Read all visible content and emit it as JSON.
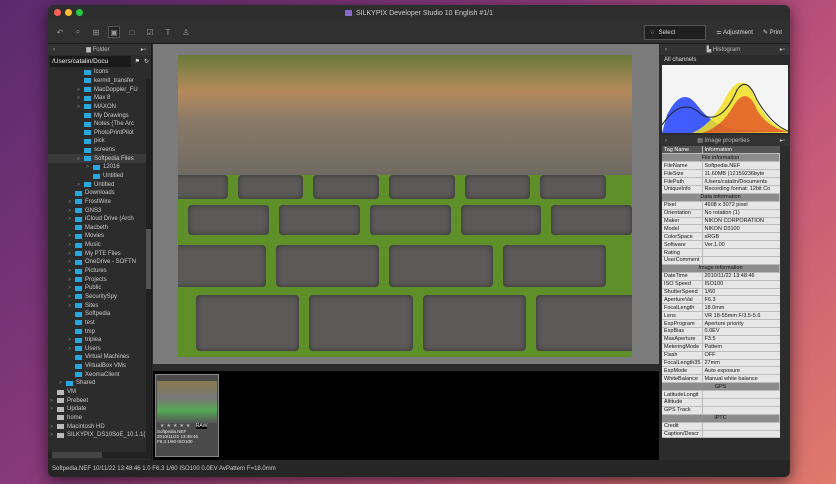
{
  "window": {
    "title": "SILKYPIX Developer Studio 10 English   #1/1"
  },
  "toolbar": {
    "select": "Select",
    "adjustment": "Adjustment",
    "print": "Print"
  },
  "folder_panel": {
    "title": "Folder",
    "path": "/Users/catalin/Docu",
    "items": [
      {
        "label": "Icons",
        "depth": 3,
        "exp": ""
      },
      {
        "label": "kermit_transfer",
        "depth": 3,
        "exp": ""
      },
      {
        "label": "MacDoppler_FU",
        "depth": 3,
        "exp": ">"
      },
      {
        "label": "Max 8",
        "depth": 3,
        "exp": ">"
      },
      {
        "label": "MAXON",
        "depth": 3,
        "exp": ">"
      },
      {
        "label": "My Drawings",
        "depth": 3,
        "exp": ""
      },
      {
        "label": "Notes (The Arc",
        "depth": 3,
        "exp": ""
      },
      {
        "label": "PhotoPrintPilot",
        "depth": 3,
        "exp": ""
      },
      {
        "label": "pick",
        "depth": 3,
        "exp": ""
      },
      {
        "label": "screens",
        "depth": 3,
        "exp": ""
      },
      {
        "label": "Softpedia Files",
        "depth": 3,
        "exp": "v",
        "sel": true
      },
      {
        "label": "12016",
        "depth": 4,
        "exp": ">"
      },
      {
        "label": "Untitled",
        "depth": 4,
        "exp": ""
      },
      {
        "label": "Untitled",
        "depth": 3,
        "exp": ">"
      },
      {
        "label": "Downloads",
        "depth": 2,
        "exp": ""
      },
      {
        "label": "FrostWire",
        "depth": 2,
        "exp": ">"
      },
      {
        "label": "GNS3",
        "depth": 2,
        "exp": ">"
      },
      {
        "label": "iCloud Drive (Arch",
        "depth": 2,
        "exp": ">"
      },
      {
        "label": "Macbeth",
        "depth": 2,
        "exp": ""
      },
      {
        "label": "Movies",
        "depth": 2,
        "exp": ">"
      },
      {
        "label": "Music",
        "depth": 2,
        "exp": ">"
      },
      {
        "label": "My PTE Files",
        "depth": 2,
        "exp": ">"
      },
      {
        "label": "OneDrive - SOFTN",
        "depth": 2,
        "exp": ">"
      },
      {
        "label": "Pictures",
        "depth": 2,
        "exp": ">"
      },
      {
        "label": "Projects",
        "depth": 2,
        "exp": ">"
      },
      {
        "label": "Public",
        "depth": 2,
        "exp": ">"
      },
      {
        "label": "SecuritySpy",
        "depth": 2,
        "exp": ">"
      },
      {
        "label": "Sites",
        "depth": 2,
        "exp": ">"
      },
      {
        "label": "Softpedia",
        "depth": 2,
        "exp": ""
      },
      {
        "label": "test",
        "depth": 2,
        "exp": ""
      },
      {
        "label": "tmp",
        "depth": 2,
        "exp": ""
      },
      {
        "label": "tripleа",
        "depth": 2,
        "exp": ">"
      },
      {
        "label": "Users",
        "depth": 2,
        "exp": ">"
      },
      {
        "label": "Virtual Machines",
        "depth": 2,
        "exp": ""
      },
      {
        "label": "VirtualBox VMs",
        "depth": 2,
        "exp": ""
      },
      {
        "label": "XeomaClient",
        "depth": 2,
        "exp": ""
      },
      {
        "label": "Shared",
        "depth": 1,
        "exp": ">"
      },
      {
        "label": "VM",
        "depth": 0,
        "exp": "",
        "g": true
      },
      {
        "label": "Prebeet",
        "depth": 0,
        "exp": ">",
        "g": true
      },
      {
        "label": "Update",
        "depth": 0,
        "exp": ">",
        "g": true
      },
      {
        "label": "home",
        "depth": 0,
        "exp": "",
        "g": true
      },
      {
        "label": "Macintosh HD",
        "depth": 0,
        "exp": ">",
        "g": true
      },
      {
        "label": "SILKYPIX_DS10SoE_10.1.1(",
        "depth": 0,
        "exp": ">",
        "g": true
      }
    ]
  },
  "thumbnail": {
    "name": "Softpedia.NEF",
    "date": "2010/11/22 13:48:46",
    "info": "F6.3 1/60 ISO100",
    "badge": "RAW"
  },
  "histogram": {
    "title": "Histogram",
    "channel": "All channels"
  },
  "properties": {
    "title": "Image properties",
    "col1": "Tag Name",
    "col2": "Information",
    "sections": [
      {
        "title": "File information",
        "rows": [
          [
            "FileName",
            "Softpedia.NEF"
          ],
          [
            "FileSize",
            "11.60MB (12159236byte"
          ],
          [
            "FilePath",
            "/Users/catalin/Documents"
          ],
          [
            "UniqueInfo",
            "Recording format: 12bit Co"
          ]
        ]
      },
      {
        "title": "Data information",
        "rows": [
          [
            "Pixel",
            "4608 x 3072 pixel"
          ],
          [
            "Orientation",
            "No rotation (1)"
          ],
          [
            "Maker",
            "NIKON CORPORATION"
          ],
          [
            "Model",
            "NIKON D3100"
          ],
          [
            "ColorSpace",
            "sRGB"
          ],
          [
            "Software",
            "Ver.1.00"
          ],
          [
            "Rating",
            ""
          ],
          [
            "UserComment",
            ""
          ]
        ]
      },
      {
        "title": "Image information",
        "rows": [
          [
            "DateTime",
            "2010/11/22 13:48:46"
          ],
          [
            "ISO Speed",
            "ISO100"
          ],
          [
            "ShutterSpeed",
            "1/60"
          ],
          [
            "ApertureVal",
            "F6.3"
          ],
          [
            "FocalLength",
            "18.0mm"
          ],
          [
            "Lens",
            "VR 18-55mm F/3.5-5.6"
          ],
          [
            "ExpProgram",
            "Aperture priority"
          ],
          [
            "ExpBias",
            "0.0EV"
          ],
          [
            "MaxAperture",
            "F3.5"
          ],
          [
            "MeteringMode",
            "Pattern"
          ],
          [
            "Flash",
            "OFF"
          ],
          [
            "FocalLength35",
            "27mm"
          ],
          [
            "ExpMode",
            "Auto exposure"
          ],
          [
            "WhiteBalance",
            "Manual white balance"
          ]
        ]
      },
      {
        "title": "GPS",
        "rows": [
          [
            "LatitudeLongit",
            ""
          ],
          [
            "Altitude",
            ""
          ],
          [
            "GPS Track",
            ""
          ]
        ]
      },
      {
        "title": "IPTC",
        "rows": [
          [
            "Credit",
            ""
          ],
          [
            "Caption/Descr",
            ""
          ]
        ]
      }
    ]
  },
  "status": "Softpedia.NEF 10/11/22 13:48:46 1.0 F6.3 1/60 ISO100  0.0EV AvPattern F=18.0mm"
}
